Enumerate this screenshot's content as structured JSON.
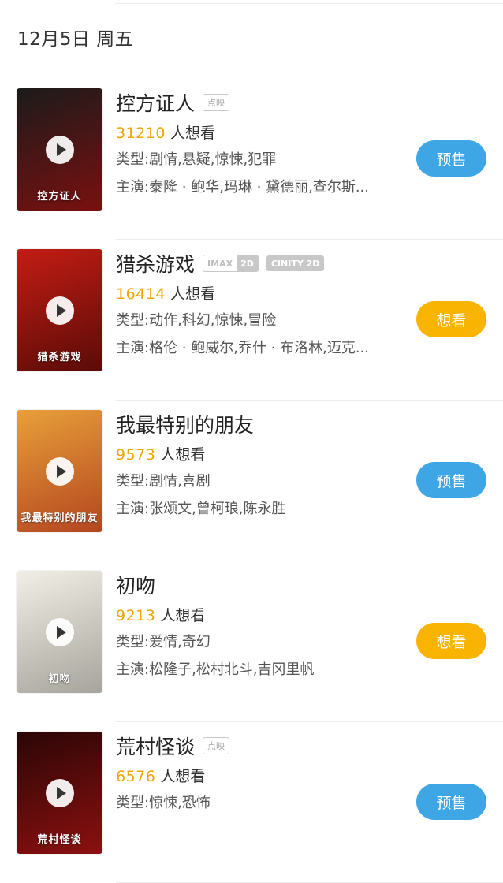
{
  "date_label": "12月5日 周五",
  "colors": {
    "want_count": "#f0a500",
    "presale_button": "#3ea6e5",
    "want_button": "#f8b400"
  },
  "movies": [
    {
      "title": "控方证人",
      "tags": [
        {
          "type": "outline",
          "text": "点映"
        }
      ],
      "want_count": "31210",
      "want_suffix": "人想看",
      "genre": "类型:剧情,悬疑,惊悚,犯罪",
      "cast": "主演:泰隆 · 鲍华,玛琳 · 黛德丽,查尔斯...",
      "button": "预售",
      "button_type": "presale",
      "poster_text": "控方证人",
      "poster_gradient": [
        "#1b1b1b",
        "#7a1010"
      ]
    },
    {
      "title": "猎杀游戏",
      "tags": [
        {
          "type": "imax",
          "text": "IMAX",
          "sub": "2D"
        },
        {
          "type": "cinity",
          "text": "CINITY 2D"
        }
      ],
      "want_count": "16414",
      "want_suffix": "人想看",
      "genre": "类型:动作,科幻,惊悚,冒险",
      "cast": "主演:格伦 · 鲍威尔,乔什 · 布洛林,迈克...",
      "button": "想看",
      "button_type": "want",
      "poster_text": "猎杀游戏",
      "poster_gradient": [
        "#c21d14",
        "#5a0b08"
      ]
    },
    {
      "title": "我最特别的朋友",
      "tags": [],
      "want_count": "9573",
      "want_suffix": "人想看",
      "genre": "类型:剧情,喜剧",
      "cast": "主演:张颂文,曾柯琅,陈永胜",
      "button": "预售",
      "button_type": "presale",
      "poster_text": "我最特别的朋友",
      "poster_gradient": [
        "#e8a03a",
        "#b3451f"
      ]
    },
    {
      "title": "初吻",
      "tags": [],
      "want_count": "9213",
      "want_suffix": "人想看",
      "genre": "类型:爱情,奇幻",
      "cast": "主演:松隆子,松村北斗,吉冈里帆",
      "button": "想看",
      "button_type": "want",
      "poster_text": "初吻",
      "poster_gradient": [
        "#f2efe6",
        "#a6a49c"
      ]
    },
    {
      "title": "荒村怪谈",
      "tags": [
        {
          "type": "outline",
          "text": "点映"
        }
      ],
      "want_count": "6576",
      "want_suffix": "人想看",
      "genre": "类型:惊悚,恐怖",
      "cast": "",
      "button": "预售",
      "button_type": "presale",
      "poster_text": "荒村怪谈",
      "poster_gradient": [
        "#2a0606",
        "#8c1010"
      ]
    }
  ]
}
